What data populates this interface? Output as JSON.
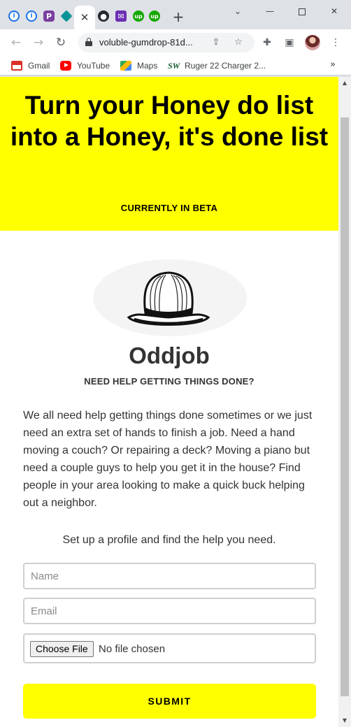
{
  "browser": {
    "tabs": [
      {
        "icon": "info-icon"
      },
      {
        "icon": "info-icon"
      },
      {
        "icon": "p-app-icon"
      },
      {
        "icon": "diamond-icon"
      },
      {
        "icon": "close-icon",
        "active": true
      },
      {
        "icon": "github-icon"
      },
      {
        "icon": "mail-icon"
      },
      {
        "icon": "upwork-icon"
      },
      {
        "icon": "upwork-icon"
      }
    ],
    "new_tab_label": "+",
    "url": "voluble-gumdrop-81d...",
    "bookmarks": [
      {
        "label": "Gmail",
        "icon": "gmail-icon"
      },
      {
        "label": "YouTube",
        "icon": "youtube-icon"
      },
      {
        "label": "Maps",
        "icon": "maps-icon"
      },
      {
        "label": "Ruger 22 Charger 2...",
        "icon": "sw-icon",
        "icon_text": "SW"
      }
    ],
    "more_bookmarks": "»"
  },
  "hero": {
    "title_prefix": "Turn your ",
    "title_bold_1": "Honey do list",
    "title_middle": " into a Honey, it's ",
    "title_bold_2": "done list",
    "beta": "CURRENTLY IN BETA",
    "background": "#ffff00"
  },
  "brand": {
    "name": "Oddjob",
    "tagline": "NEED HELP GETTING THINGS DONE?"
  },
  "description": "We all need help getting things done sometimes or we just need an extra set of hands to finish a job. Need a hand moving a couch? Or repairing a deck? Moving a piano but need a couple guys to help you get it in the house? Find people in your area looking to make a quick buck helping out a neighbor.",
  "signup": {
    "lead": "Set up a profile and find the help you need.",
    "name_placeholder": "Name",
    "email_placeholder": "Email",
    "file_button": "Choose File",
    "file_status": "No file chosen",
    "submit_label": "SUBMIT",
    "accent": "#ffff00"
  }
}
